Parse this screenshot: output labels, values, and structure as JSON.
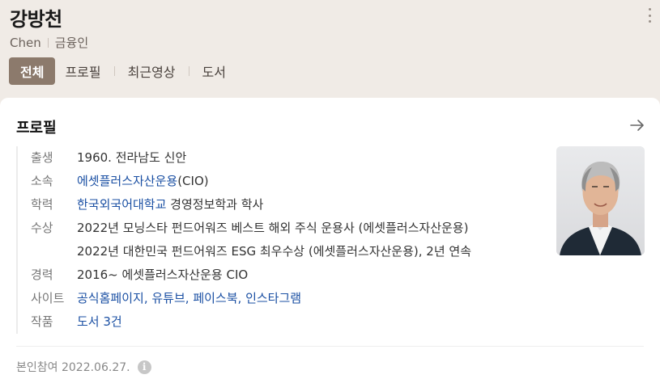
{
  "header": {
    "name": "강방천",
    "english_name": "Chen",
    "occupation": "금융인",
    "more_icon": "more-vertical-icon",
    "tabs": [
      {
        "label": "전체",
        "active": true
      },
      {
        "label": "프로필",
        "active": false
      },
      {
        "label": "최근영상",
        "active": false
      },
      {
        "label": "도서",
        "active": false
      }
    ]
  },
  "profile": {
    "title": "프로필",
    "arrow_icon": "arrow-right-icon",
    "rows": [
      {
        "label": "출생",
        "value": "1960. 전라남도 신안"
      },
      {
        "label": "소속",
        "link": "에셋플러스자산운용",
        "suffix": "(CIO)"
      },
      {
        "label": "학력",
        "link": "한국외국어대학교",
        "suffix": " 경영정보학과 학사"
      },
      {
        "label": "수상",
        "lines": [
          "2022년 모닝스타 펀드어워즈 베스트 해외 주식 운용사 (에셋플러스자산운용)",
          "2022년 대한민국 펀드어워즈 ESG 최우수상 (에셋플러스자산운용), 2년 연속"
        ]
      },
      {
        "label": "경력",
        "value": "2016~ 에셋플러스자산운용 CIO"
      },
      {
        "label": "사이트",
        "links": [
          "공식홈페이지",
          "유튜브",
          "페이스북",
          "인스타그램"
        ]
      },
      {
        "label": "작품",
        "link": "도서 3건"
      }
    ],
    "photo_icon": "profile-photo",
    "footer": "본인참여 2022.06.27.",
    "info_icon": "info-icon"
  },
  "colors": {
    "header_bg": "#f0ebe6",
    "tab_active_bg": "#8c7a6c",
    "link": "#1a4fa3"
  }
}
